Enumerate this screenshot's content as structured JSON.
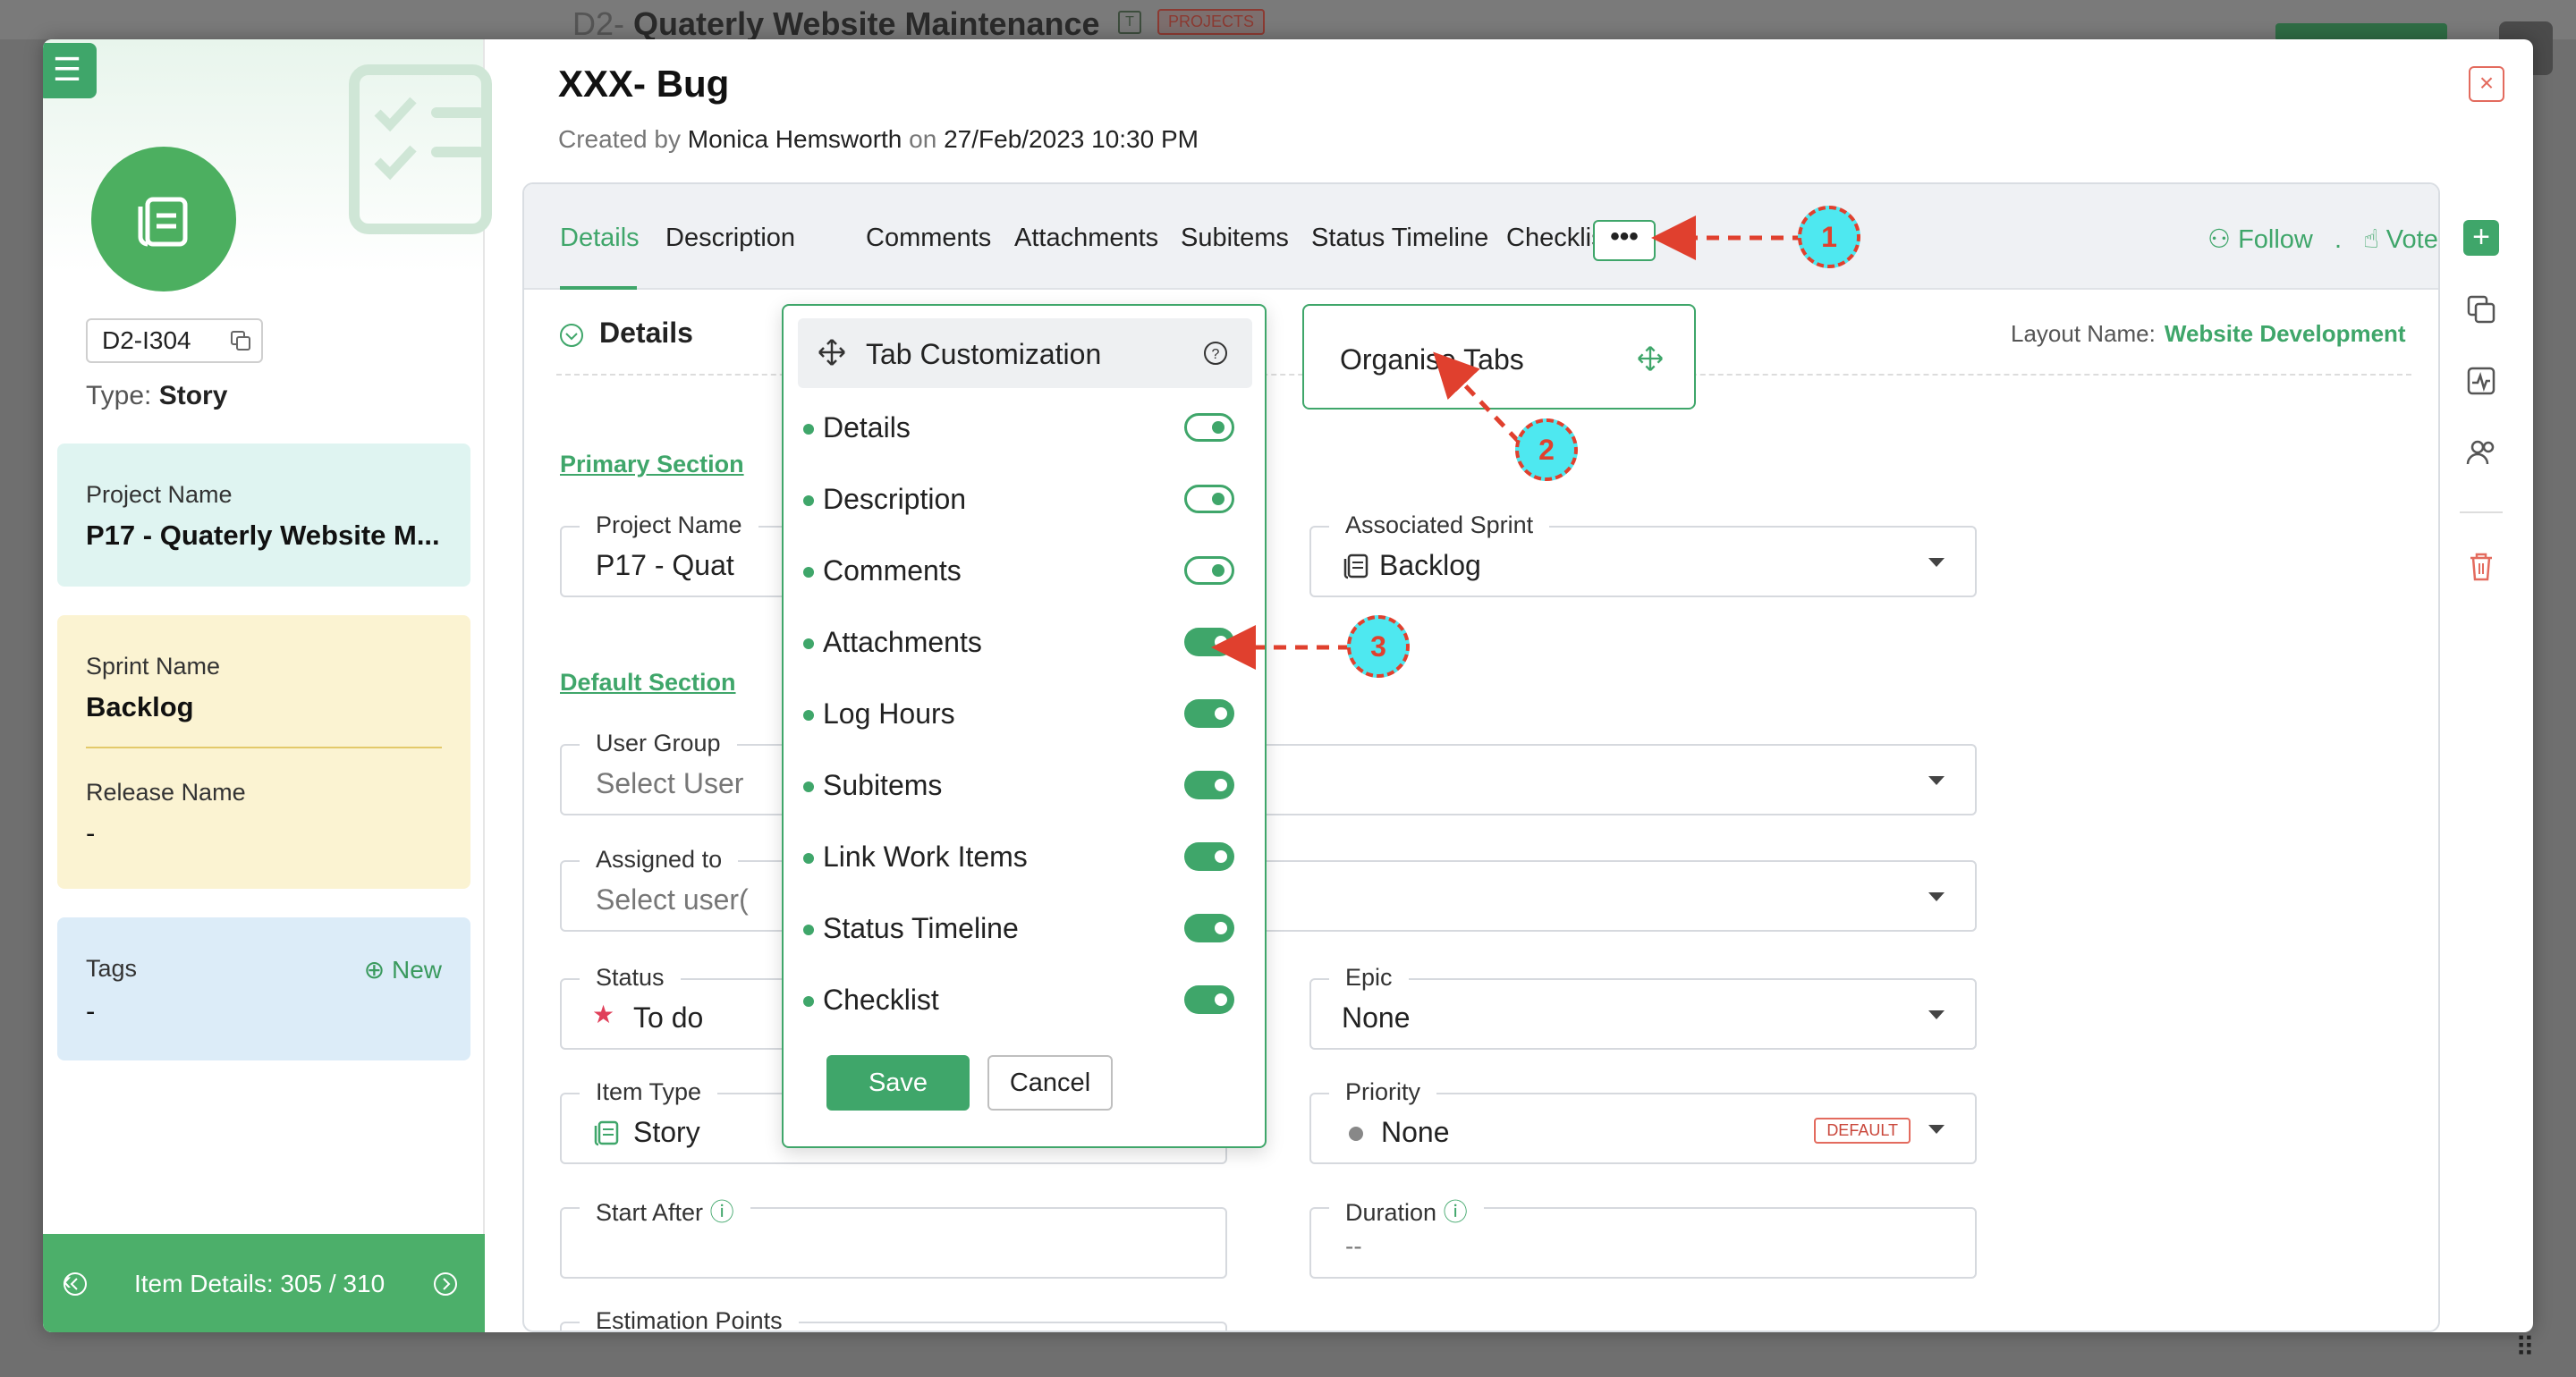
{
  "background": {
    "title_prefix": "D2-",
    "title": "Quaterly Website Maintenance",
    "t_box": "T",
    "badge": "PROJECTS"
  },
  "left": {
    "item_id": "D2-I304",
    "type_label": "Type:",
    "type_value": "Story",
    "project_label": "Project Name",
    "project_value": "P17 - Quaterly Website M...",
    "sprint_label": "Sprint Name",
    "sprint_value": "Backlog",
    "release_label": "Release Name",
    "release_value": "-",
    "tags_label": "Tags",
    "tags_new": "New",
    "tags_value": "-",
    "footer_label": "Item Details: 305 / 310"
  },
  "header": {
    "title": "XXX- Bug",
    "created_by_label": "Created by",
    "created_by": "Monica Hemsworth",
    "on_label": "on",
    "created_on": "27/Feb/2023 10:30 PM"
  },
  "tabs": [
    {
      "label": "Details"
    },
    {
      "label": "Description"
    },
    {
      "label": "Comments"
    },
    {
      "label": "Attachments"
    },
    {
      "label": "Subitems"
    },
    {
      "label": "Status Timeline"
    },
    {
      "label": "Checklist"
    }
  ],
  "tab_more": "•••",
  "actions": {
    "follow": "Follow",
    "separator": ".",
    "vote": "Vote"
  },
  "details": {
    "heading": "Details",
    "layout_label": "Layout Name:",
    "layout_value": "Website Development",
    "primary_section": "Primary Section",
    "default_section": "Default Section"
  },
  "fields": {
    "project_name": {
      "label": "Project Name",
      "value": "P17 - Quat"
    },
    "associated_sprint": {
      "label": "Associated Sprint",
      "value": "Backlog"
    },
    "user_group": {
      "label": "User Group",
      "placeholder": "Select User"
    },
    "assigned_to": {
      "label": "Assigned to",
      "placeholder": "Select user("
    },
    "status": {
      "label": "Status",
      "value": "To do"
    },
    "epic": {
      "label": "Epic",
      "value": "None"
    },
    "item_type": {
      "label": "Item Type",
      "value": "Story"
    },
    "priority": {
      "label": "Priority",
      "value": "None",
      "badge": "DEFAULT"
    },
    "start_after": {
      "label": "Start After",
      "value": ""
    },
    "duration": {
      "label": "Duration",
      "value": "--"
    },
    "estimation_points": {
      "label": "Estimation Points"
    }
  },
  "popover": {
    "title": "Tab Customization",
    "items": [
      {
        "label": "Details",
        "enabled": false
      },
      {
        "label": "Description",
        "enabled": false
      },
      {
        "label": "Comments",
        "enabled": false
      },
      {
        "label": "Attachments",
        "enabled": true
      },
      {
        "label": "Log Hours",
        "enabled": true
      },
      {
        "label": "Subitems",
        "enabled": true
      },
      {
        "label": "Link Work Items",
        "enabled": true
      },
      {
        "label": "Status Timeline",
        "enabled": true
      },
      {
        "label": "Checklist",
        "enabled": true
      }
    ],
    "save": "Save",
    "cancel": "Cancel"
  },
  "organise": {
    "label": "Organise Tabs"
  },
  "annotations": [
    "1",
    "2",
    "3"
  ],
  "colors": {
    "accent": "#3fa66a",
    "danger": "#e36b5e",
    "callout": "#4ee8f0"
  }
}
